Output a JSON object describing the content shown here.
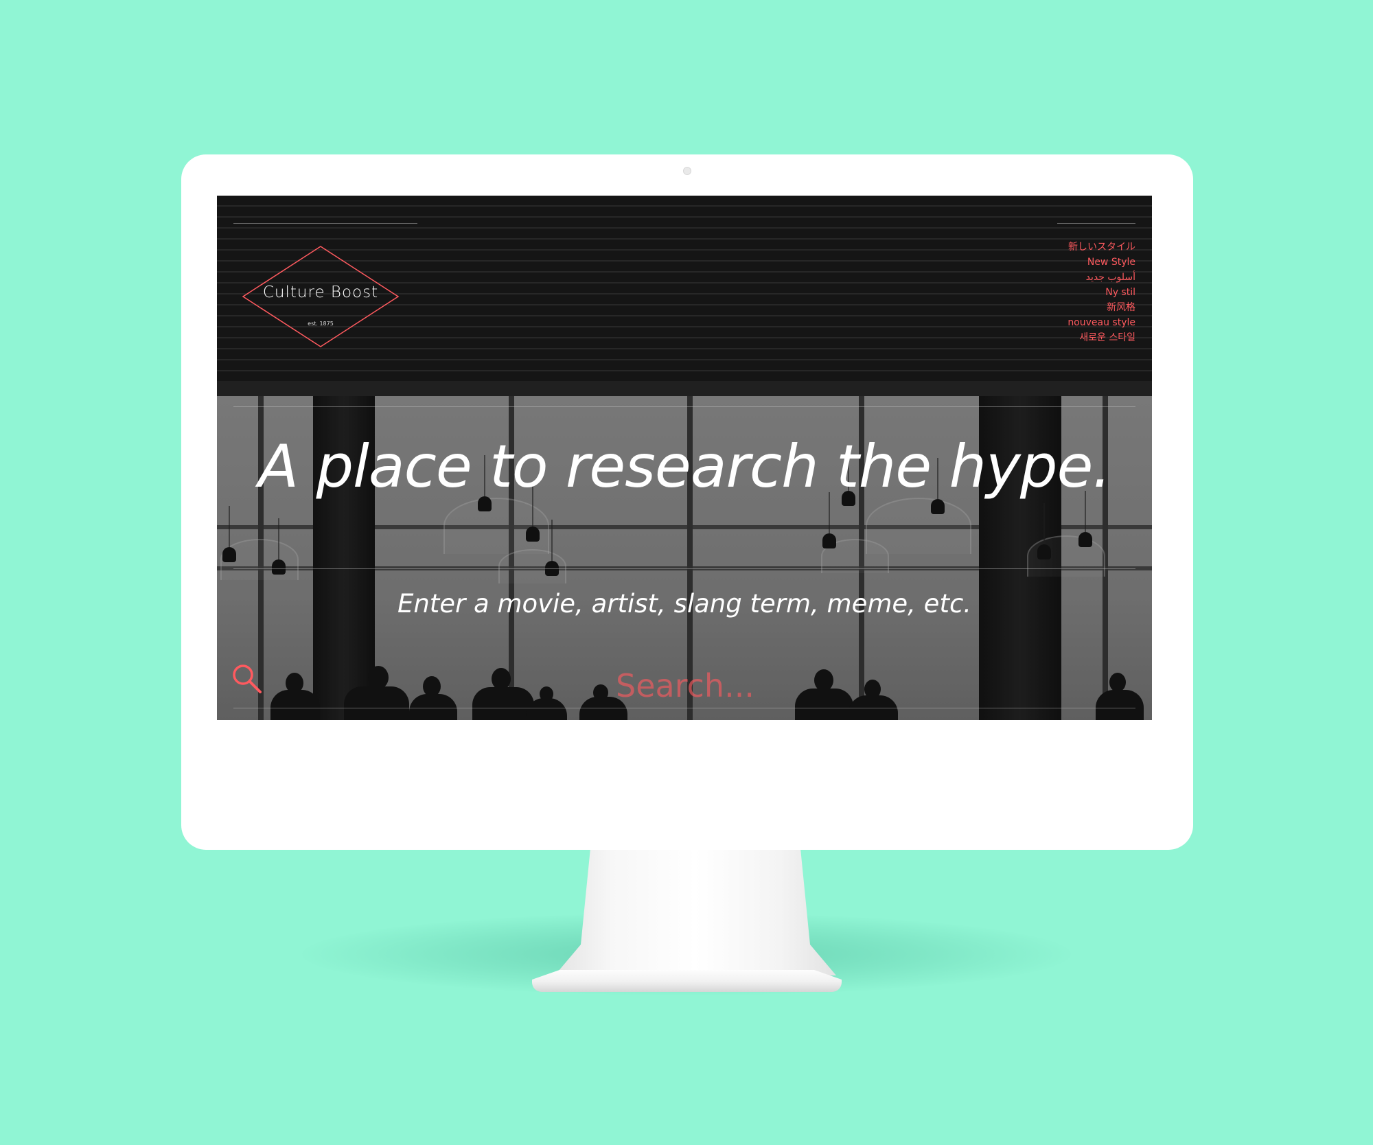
{
  "logo": {
    "name": "Culture Boost",
    "tagline": "est. 1875"
  },
  "languages": [
    "新しいスタイル",
    "New Style",
    "أسلوب جديد",
    "Ny stil",
    "新风格",
    "nouveau style",
    "새로운 스타일"
  ],
  "hero": {
    "headline": "A place to research the hype.",
    "subheadline": "Enter a movie, artist, slang term, meme, etc."
  },
  "search": {
    "placeholder": "Search...",
    "value": "",
    "icon": "search-icon"
  },
  "colors": {
    "background": "#90f5d4",
    "accent": "#ff5a5f",
    "text": "#ffffff"
  }
}
